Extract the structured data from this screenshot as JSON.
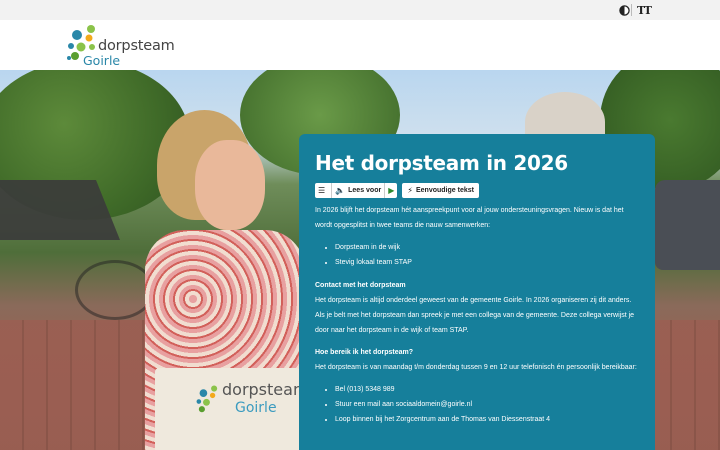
{
  "topbar": {
    "contrast_icon": "contrast-icon",
    "text_size_icon": "text-size-icon",
    "text_size_glyph": "TT"
  },
  "header": {
    "logo": {
      "word": "dorpsteam",
      "place": "Goirle"
    }
  },
  "hero": {
    "bag_logo": {
      "word": "dorpsteam",
      "place": "Goirle"
    }
  },
  "card": {
    "title": "Het dorpsteam in 2026",
    "readspeaker": {
      "menu_icon": "menu-icon",
      "read_label": "Lees voor",
      "play_icon": "play-icon",
      "simple_label": "Eenvoudige tekst"
    },
    "intro": "In 2026 blijft het dorpsteam hét aanspreekpunt voor al jouw ondersteuningsvragen. Nieuw is dat het wordt opgesplitst in twee teams die nauw samenwerken:",
    "teams": [
      "Dorpsteam in de wijk",
      "Stevig lokaal team STAP"
    ],
    "contact_heading": "Contact met het dorpsteam",
    "contact_text": "Het dorpsteam is altijd onderdeel geweest van de gemeente Goirle. In 2026 organiseren zij dit anders. Als je belt met het dorpsteam dan spreek je met een collega van de gemeente. Deze collega verwijst je door naar het dorpsteam in de wijk of team STAP.",
    "reach_heading": "Hoe bereik ik het dorpsteam?",
    "reach_text": "Het dorpsteam is van maandag t/m donderdag tussen 9 en 12 uur telefonisch én persoonlijk bereikbaar:",
    "reach_items": [
      "Bel (013) 5348 989",
      "Stuur een mail aan sociaaldomein@goirle.nl",
      "Loop binnen bij het Zorgcentrum aan de Thomas van Diessenstraat 4"
    ]
  }
}
